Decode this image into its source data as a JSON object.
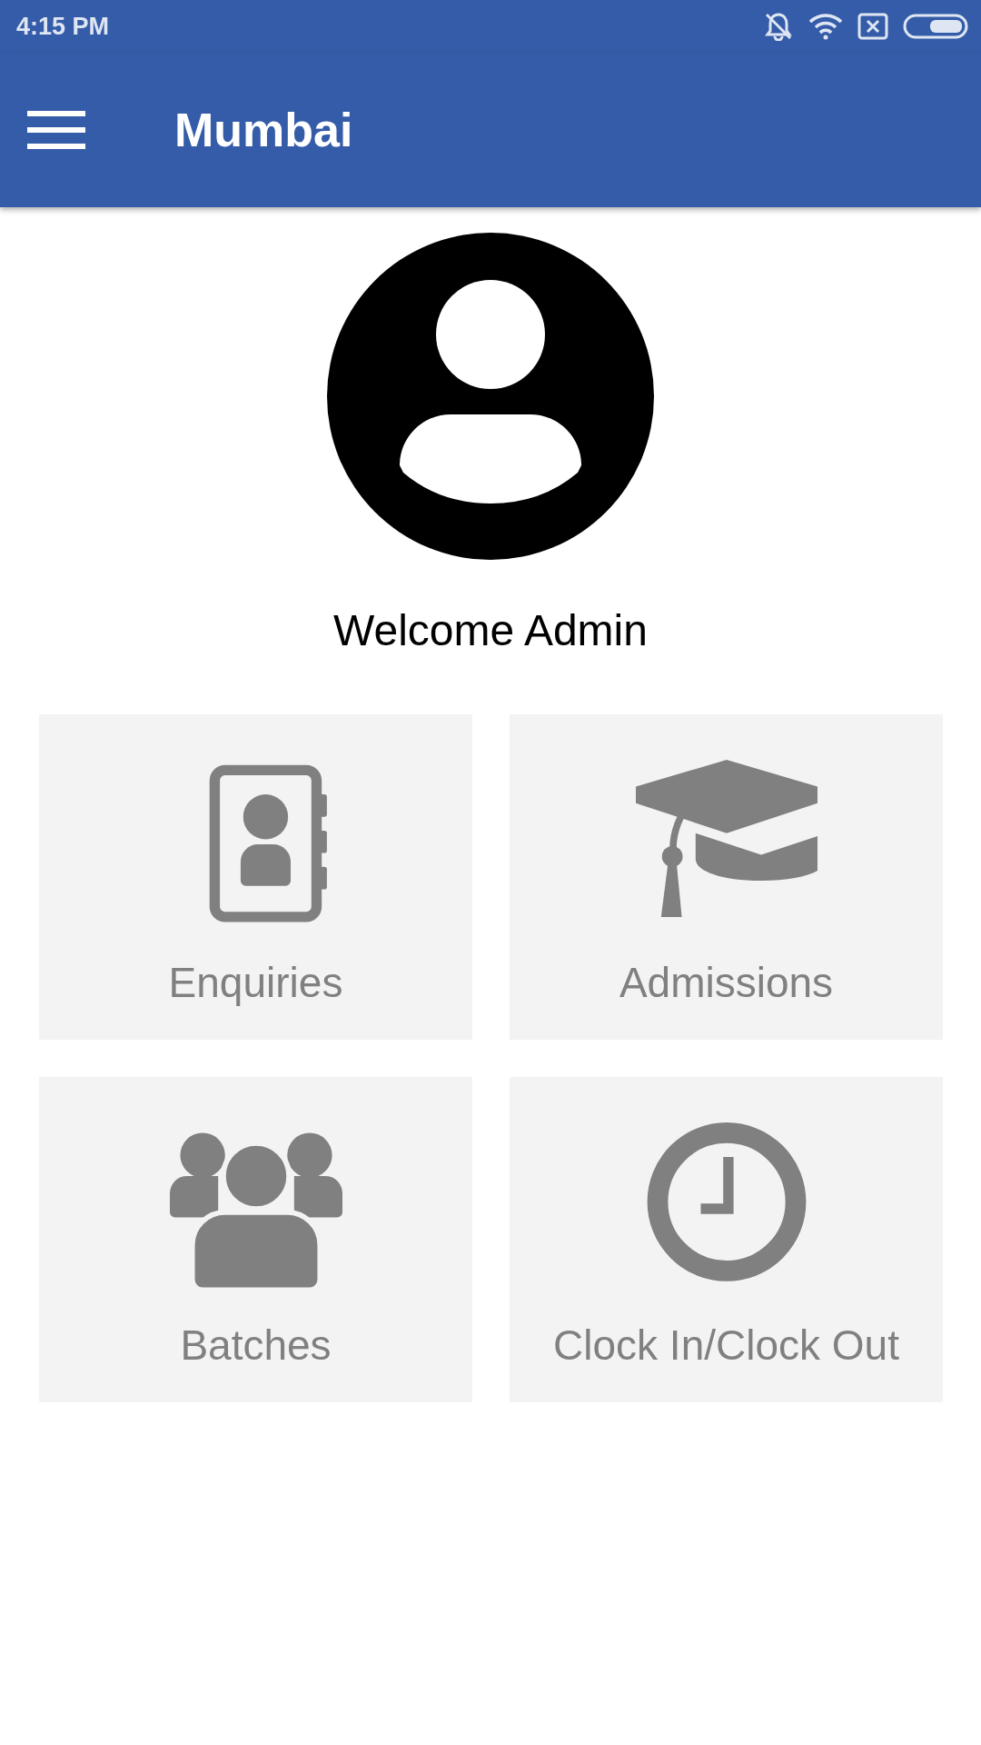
{
  "status_bar": {
    "time": "4:15 PM"
  },
  "app_bar": {
    "title": "Mumbai"
  },
  "welcome": "Welcome Admin",
  "tiles": [
    {
      "kind": "contacts",
      "label": "Enquiries"
    },
    {
      "kind": "graduation",
      "label": "Admissions"
    },
    {
      "kind": "group",
      "label": "Batches"
    },
    {
      "kind": "clock",
      "label": "Clock In/Clock Out"
    }
  ]
}
